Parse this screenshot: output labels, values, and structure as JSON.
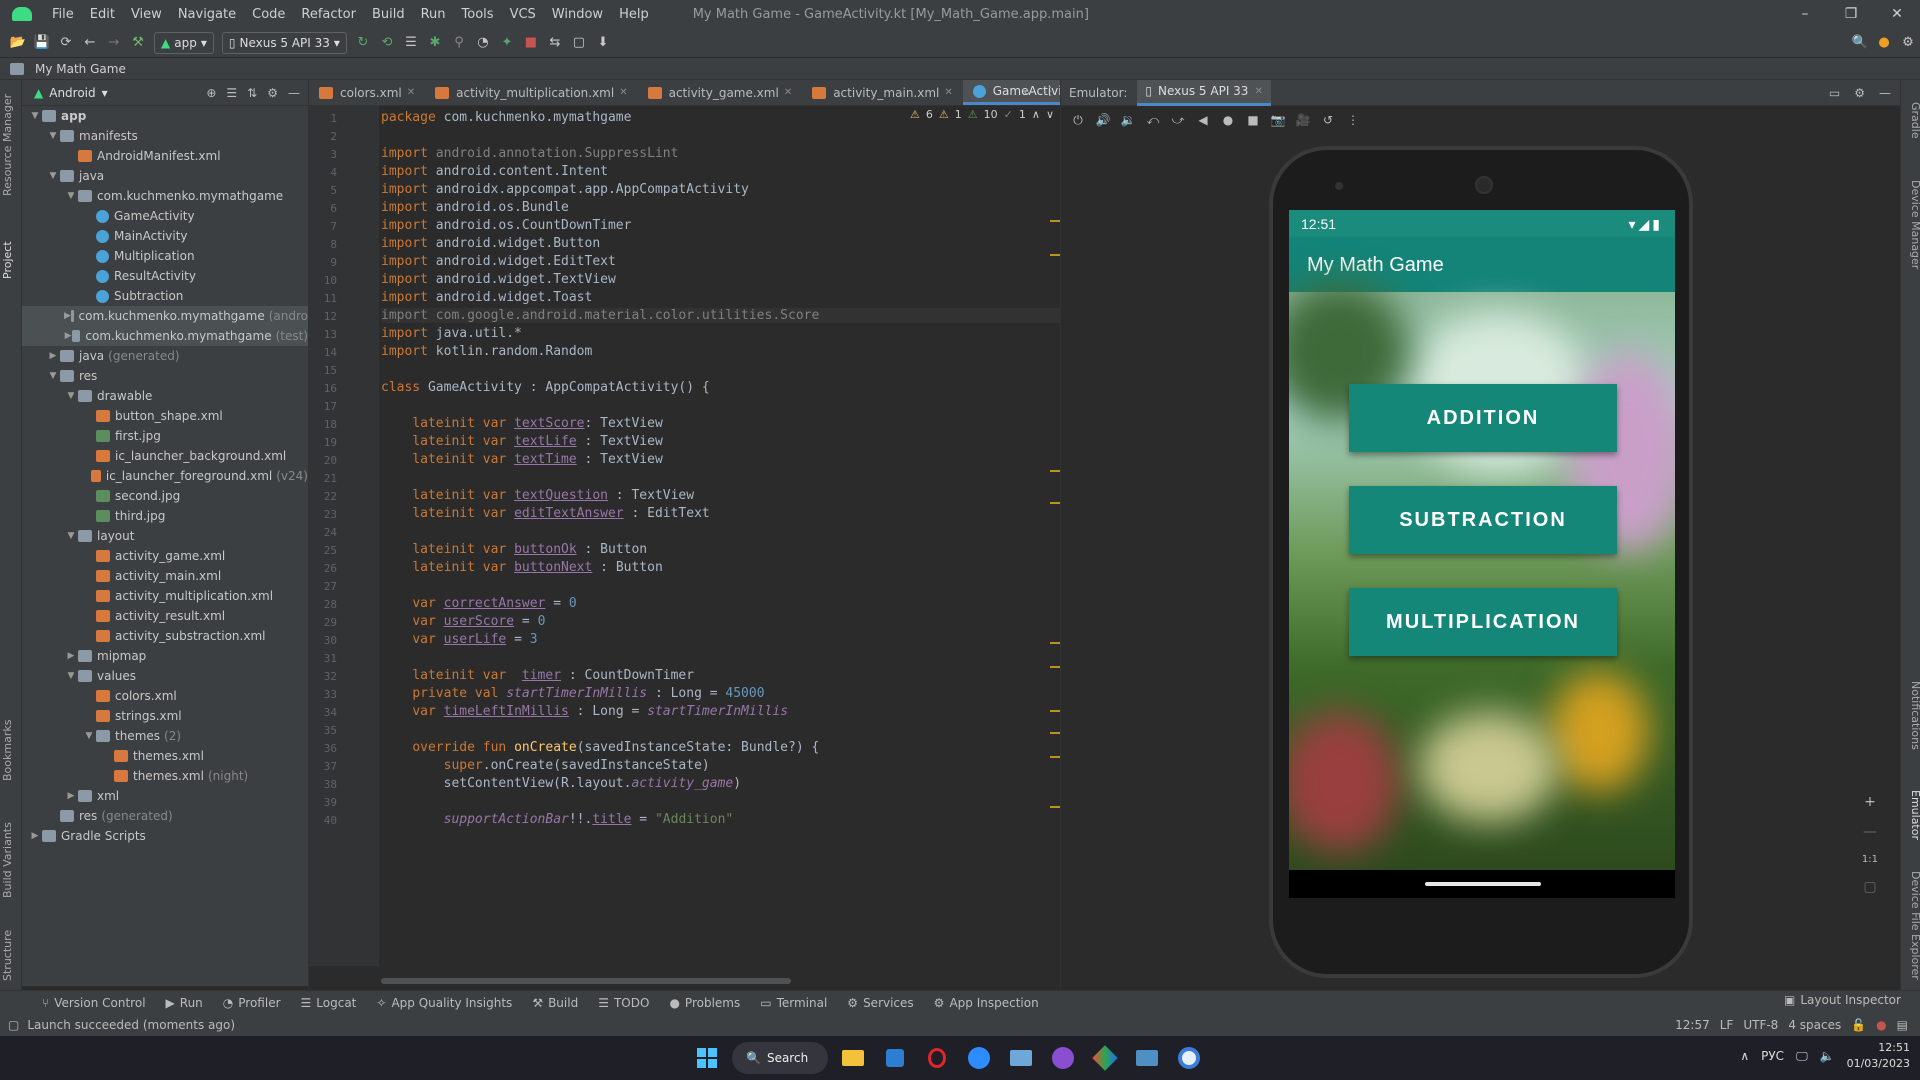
{
  "title_bar": {
    "menu": [
      "File",
      "Edit",
      "View",
      "Navigate",
      "Code",
      "Refactor",
      "Build",
      "Run",
      "Tools",
      "VCS",
      "Window",
      "Help"
    ],
    "window_title": "My Math Game - GameActivity.kt [My_Math_Game.app.main]"
  },
  "toolbar": {
    "module": "app",
    "device": "Nexus 5 API 33"
  },
  "breadcrumb": "My Math Game",
  "left_strip": [
    "Resource Manager",
    "Project",
    "Bookmarks",
    "Build Variants",
    "Structure"
  ],
  "project": {
    "view": "Android",
    "tree": [
      {
        "d": 0,
        "open": true,
        "icon": "folder",
        "label": "app",
        "bold": true
      },
      {
        "d": 1,
        "open": true,
        "icon": "folder",
        "label": "manifests"
      },
      {
        "d": 2,
        "icon": "xml",
        "label": "AndroidManifest.xml"
      },
      {
        "d": 1,
        "open": true,
        "icon": "folder",
        "label": "java"
      },
      {
        "d": 2,
        "open": true,
        "icon": "folder",
        "label": "com.kuchmenko.mymathgame"
      },
      {
        "d": 3,
        "icon": "kt",
        "label": "GameActivity"
      },
      {
        "d": 3,
        "icon": "kt",
        "label": "MainActivity"
      },
      {
        "d": 3,
        "icon": "kt",
        "label": "Multiplication"
      },
      {
        "d": 3,
        "icon": "kt",
        "label": "ResultActivity"
      },
      {
        "d": 3,
        "icon": "kt",
        "label": "Subtraction"
      },
      {
        "d": 2,
        "open": false,
        "icon": "folder",
        "label": "com.kuchmenko.mymathgame",
        "suffix": "(andro",
        "hl": true
      },
      {
        "d": 2,
        "open": false,
        "icon": "folder",
        "label": "com.kuchmenko.mymathgame",
        "suffix": "(test)",
        "hl": true
      },
      {
        "d": 1,
        "open": false,
        "icon": "folder",
        "label": "java",
        "suffix": "(generated)"
      },
      {
        "d": 1,
        "open": true,
        "icon": "folder",
        "label": "res"
      },
      {
        "d": 2,
        "open": true,
        "icon": "folder",
        "label": "drawable"
      },
      {
        "d": 3,
        "icon": "xml",
        "label": "button_shape.xml"
      },
      {
        "d": 3,
        "icon": "img",
        "label": "first.jpg"
      },
      {
        "d": 3,
        "icon": "xml",
        "label": "ic_launcher_background.xml"
      },
      {
        "d": 3,
        "icon": "xml",
        "label": "ic_launcher_foreground.xml",
        "suffix": "(v24)"
      },
      {
        "d": 3,
        "icon": "img",
        "label": "second.jpg"
      },
      {
        "d": 3,
        "icon": "img",
        "label": "third.jpg"
      },
      {
        "d": 2,
        "open": true,
        "icon": "folder",
        "label": "layout"
      },
      {
        "d": 3,
        "icon": "xml",
        "label": "activity_game.xml"
      },
      {
        "d": 3,
        "icon": "xml",
        "label": "activity_main.xml"
      },
      {
        "d": 3,
        "icon": "xml",
        "label": "activity_multiplication.xml"
      },
      {
        "d": 3,
        "icon": "xml",
        "label": "activity_result.xml"
      },
      {
        "d": 3,
        "icon": "xml",
        "label": "activity_substraction.xml"
      },
      {
        "d": 2,
        "open": false,
        "icon": "folder",
        "label": "mipmap"
      },
      {
        "d": 2,
        "open": true,
        "icon": "folder",
        "label": "values"
      },
      {
        "d": 3,
        "icon": "xml",
        "label": "colors.xml"
      },
      {
        "d": 3,
        "icon": "xml",
        "label": "strings.xml"
      },
      {
        "d": 3,
        "open": true,
        "icon": "folder",
        "label": "themes",
        "suffix": "(2)"
      },
      {
        "d": 4,
        "icon": "xml",
        "label": "themes.xml"
      },
      {
        "d": 4,
        "icon": "xml",
        "label": "themes.xml",
        "suffix": "(night)"
      },
      {
        "d": 2,
        "open": false,
        "icon": "folder",
        "label": "xml"
      },
      {
        "d": 1,
        "icon": "folder",
        "label": "res",
        "suffix": "(generated)"
      },
      {
        "d": 0,
        "open": false,
        "icon": "folder",
        "label": "Gradle Scripts"
      }
    ]
  },
  "editor": {
    "tabs": [
      {
        "label": "colors.xml"
      },
      {
        "label": "activity_multiplication.xml"
      },
      {
        "label": "activity_game.xml"
      },
      {
        "label": "activity_main.xml"
      },
      {
        "label": "GameActivity.kt",
        "active": true
      }
    ],
    "inspections": {
      "warnings": "6",
      "weak": "1",
      "typos": "10",
      "ok": "1"
    },
    "lines": [
      "<span class=\"kw\">package</span> com.kuchmenko.mymathgame",
      "",
      "<span class=\"kw\">import</span> <span class=\"grey\">android.annotation.SuppressLint</span>",
      "<span class=\"kw\">import</span> android.content.Intent",
      "<span class=\"kw\">import</span> androidx.appcompat.app.AppCompatActivity",
      "<span class=\"kw\">import</span> android.os.Bundle",
      "<span class=\"kw\">import</span> android.os.CountDownTimer",
      "<span class=\"kw\">import</span> android.widget.Button",
      "<span class=\"kw\">import</span> android.widget.EditText",
      "<span class=\"kw\">import</span> android.widget.TextView",
      "<span class=\"kw\">import</span> android.widget.Toast",
      "<span class=\"grey\">import com.google.android.material.color.utilities.Score</span>",
      "<span class=\"kw\">import</span> java.util.*",
      "<span class=\"kw\">import</span> kotlin.random.Random",
      "",
      "<span class=\"kw\">class</span> GameActivity : AppCompatActivity() {",
      "",
      "    <span class=\"kw\">lateinit var</span> <span class=\"id\">textScore</span>: TextView",
      "    <span class=\"kw\">lateinit var</span> <span class=\"id\">textLife</span> : TextView",
      "    <span class=\"kw\">lateinit var</span> <span class=\"id\">textTime</span> : TextView",
      "",
      "    <span class=\"kw\">lateinit var</span> <span class=\"id\">textQuestion</span> : TextView",
      "    <span class=\"kw\">lateinit var</span> <span class=\"id\">editTextAnswer</span> : EditText",
      "",
      "    <span class=\"kw\">lateinit var</span> <span class=\"id\">buttonOk</span> : Button",
      "    <span class=\"kw\">lateinit var</span> <span class=\"id\">buttonNext</span> : Button",
      "",
      "    <span class=\"kw\">var</span> <span class=\"id\">correctAnswer</span> = <span class=\"num\">0</span>",
      "    <span class=\"kw\">var</span> <span class=\"id\">userScore</span> = <span class=\"num\">0</span>",
      "    <span class=\"kw\">var</span> <span class=\"id\">userLife</span> = <span class=\"num\">3</span>",
      "",
      "    <span class=\"kw\">lateinit var</span>  <span class=\"id\">timer</span> : CountDownTimer",
      "    <span class=\"kw\">private val</span> <span class=\"it\">startTimerInMillis</span> : Long = <span class=\"num\">45000</span>",
      "    <span class=\"kw\">var</span> <span class=\"id\">timeLeftInMillis</span> : Long = <span class=\"it\">startTimerInMillis</span>",
      "",
      "    <span class=\"kw\">override fun</span> <span class=\"fn\">onCreate</span>(savedInstanceState: Bundle?) {",
      "        <span class=\"kw\">super</span>.onCreate(savedInstanceState)",
      "        setContentView(R.layout.<span class=\"it\">activity_game</span>)",
      "",
      "        <span class=\"it\">supportActionBar</span>!!.<span class=\"id\">title</span> = <span class=\"str\">\"Addition\"</span>"
    ]
  },
  "emulator": {
    "label": "Emulator:",
    "device_tab": "Nexus 5 API 33"
  },
  "phone": {
    "time": "12:51",
    "app_title": "My Math Game",
    "buttons": [
      "ADDITION",
      "SUBTRACTION",
      "MULTIPLICATION"
    ]
  },
  "right_strip": [
    "Gradle",
    "Device Manager",
    "Notifications",
    "Emulator",
    "Device File Explorer"
  ],
  "bottom_tabs": [
    "Version Control",
    "Run",
    "Profiler",
    "Logcat",
    "App Quality Insights",
    "Build",
    "TODO",
    "Problems",
    "Terminal",
    "Services",
    "App Inspection"
  ],
  "layout_inspector": "Layout Inspector",
  "status": {
    "message": "Launch succeeded (moments ago)",
    "position": "12:57",
    "line_sep": "LF",
    "encoding": "UTF-8",
    "indent": "4 spaces"
  },
  "taskbar": {
    "search": "Search",
    "lang": "РУС",
    "time": "12:51",
    "date": "01/03/2023"
  },
  "colors": {
    "accent": "#148478",
    "ide_bg": "#2b2b2b",
    "panel": "#3c3f41"
  }
}
